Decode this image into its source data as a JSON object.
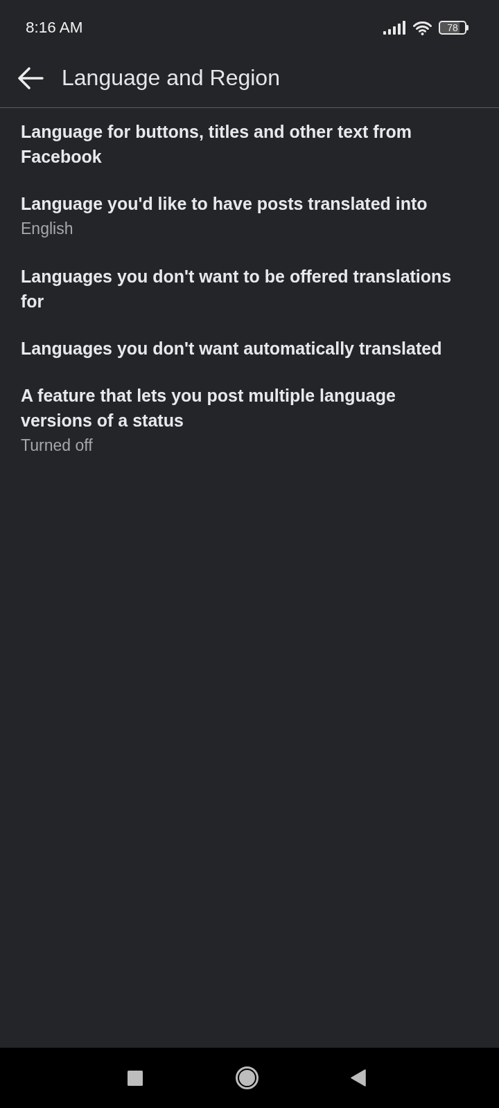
{
  "status_bar": {
    "time": "8:16 AM",
    "battery": "78"
  },
  "header": {
    "title": "Language and Region"
  },
  "settings": [
    {
      "title": "Language for buttons, titles and other text from Facebook"
    },
    {
      "title": "Language you'd like to have posts translated into",
      "value": "English"
    },
    {
      "title": "Languages you don't want to be offered translations for"
    },
    {
      "title": "Languages you don't want automatically translated"
    },
    {
      "title": "A feature that lets you post multiple language versions of a status",
      "value": "Turned off"
    }
  ]
}
